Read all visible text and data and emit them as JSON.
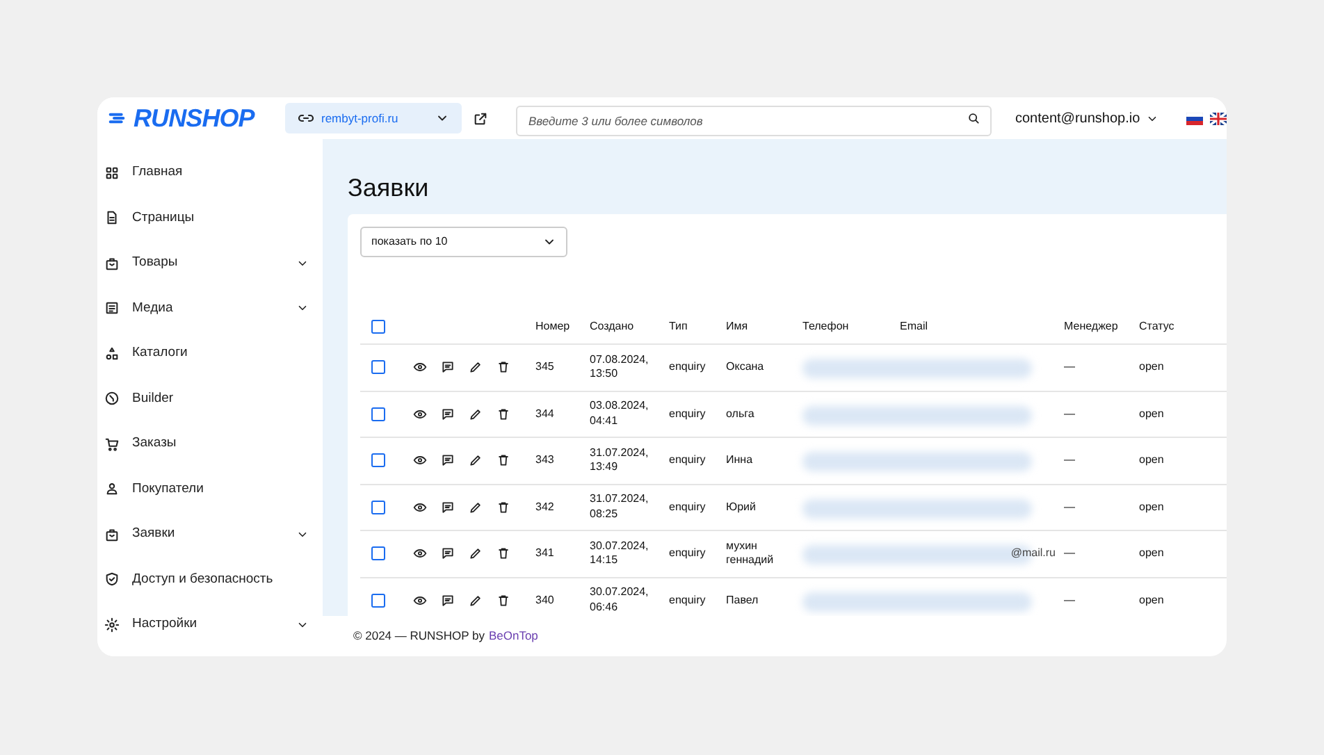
{
  "header": {
    "logo": "RUNSHOP",
    "site": "rembyt-profi.ru",
    "search": {
      "placeholder": "Введите 3 или более символов"
    },
    "user": "content@runshop.io",
    "languages": [
      {
        "kind": "tricolor"
      },
      {
        "kind": "unionjack"
      }
    ]
  },
  "sidebar": {
    "items": [
      {
        "label": "Главная",
        "expandable": false
      },
      {
        "label": "Страницы",
        "expandable": false
      },
      {
        "label": "Товары",
        "expandable": true
      },
      {
        "label": "Медиа",
        "expandable": true
      },
      {
        "label": "Каталоги",
        "expandable": false
      },
      {
        "label": "Builder",
        "expandable": false
      },
      {
        "label": "Заказы",
        "expandable": false
      },
      {
        "label": "Покупатели",
        "expandable": false
      },
      {
        "label": "Заявки",
        "expandable": true
      },
      {
        "label": "Доступ и безопасность",
        "expandable": false
      },
      {
        "label": "Настройки",
        "expandable": true
      }
    ]
  },
  "page_title": "Заявки",
  "page_size": "показать по 10",
  "table": {
    "all_checked": false,
    "columns": [
      "Номер",
      "Создано",
      "Тип",
      "Имя",
      "Телефон",
      "Email",
      "Менеджер",
      "Статус"
    ],
    "rows": [
      {
        "number": "345",
        "created": "07.08.2024, 13:50",
        "type": "enquiry",
        "name": "Оксана",
        "manager": "—",
        "status": "open",
        "checked": false
      },
      {
        "number": "344",
        "created": "03.08.2024, 04:41",
        "type": "enquiry",
        "name": "ольга",
        "manager": "—",
        "status": "open",
        "checked": false
      },
      {
        "number": "343",
        "created": "31.07.2024, 13:49",
        "type": "enquiry",
        "name": "Инна",
        "manager": "—",
        "status": "open",
        "checked": false
      },
      {
        "number": "342",
        "created": "31.07.2024, 08:25",
        "type": "enquiry",
        "name": "Юрий",
        "manager": "—",
        "status": "open",
        "checked": false
      },
      {
        "number": "341",
        "created": "30.07.2024, 14:15",
        "type": "enquiry",
        "name": "мухин геннадий",
        "email": "@mail.ru",
        "manager": "—",
        "status": "open",
        "checked": false
      },
      {
        "number": "340",
        "created": "30.07.2024, 06:46",
        "type": "enquiry",
        "name": "Павел",
        "manager": "—",
        "status": "open",
        "checked": false
      }
    ]
  },
  "footer": {
    "text": "© 2024 — RUNSHOP by",
    "link": "BeOnTop"
  }
}
